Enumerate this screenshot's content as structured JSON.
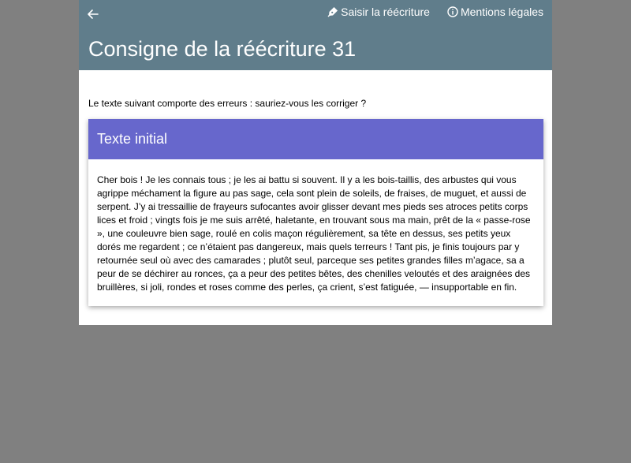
{
  "header": {
    "back_icon": "arrow-left-icon",
    "links": [
      {
        "icon": "pen-nib-icon",
        "label": "Saisir la réécriture"
      },
      {
        "icon": "info-circle-icon",
        "label": "Mentions légales"
      }
    ],
    "title": "Consigne de la réécriture 31",
    "color": "#607d8b"
  },
  "main": {
    "intro": "Le texte suivant comporte des erreurs : sauriez-vous les corriger ?",
    "card": {
      "title": "Texte initial",
      "color": "#6767cc",
      "text": "Cher bois ! Je les connais tous ; je les ai battu si souvent. Il y a les bois-taillis, des arbustes qui vous agrippe méchament la figure au pas sage, cela sont plein de soleils, de fraises, de muguet, et aussi de serpent. J’y ai tressaillie de frayeurs sufocantes avoir glisser devant mes pieds ses atroces petits corps lices et froid ; vingts fois je me suis arrêté, haletante, en trouvant sous ma main, prêt de la « passe-rose », une couleuvre bien sage, roulé en colis maçon régulièrement, sa tête en dessus, ses petits yeux dorés me regardent ; ce n’étaient pas dangereux, mais quels terreurs ! Tant pis, je finis toujours par y retournée seul où avec des camarades ; plutôt seul, parceque ses petites grandes filles m’agace, sa a peur de se déchirer au ronces, ça a peur des petites bêtes, des chenilles veloutés et des araignées des bruillères, si joli, rondes et roses comme des perles, ça crient, s’est fatiguée, — insupportable en fin."
    }
  }
}
